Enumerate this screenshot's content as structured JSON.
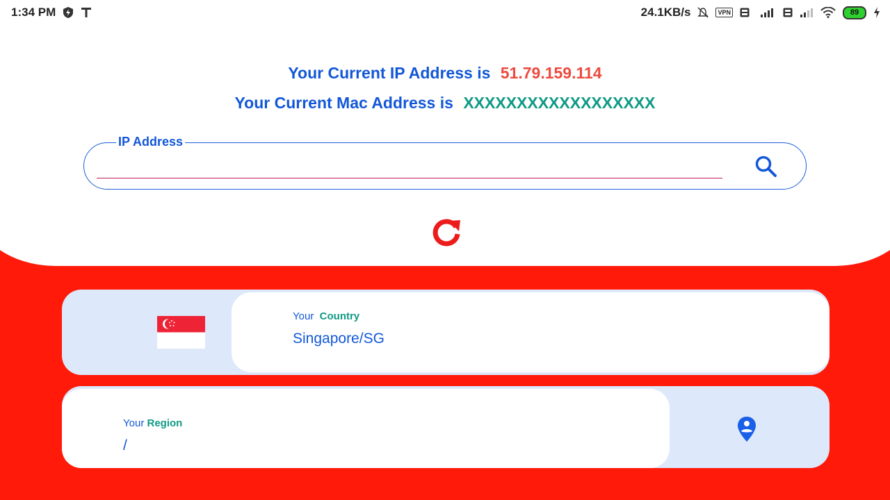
{
  "status_bar": {
    "time": "1:34 PM",
    "network_speed": "24.1KB/s",
    "vpn_label": "VPN",
    "battery_level": "89",
    "icons": [
      "shield-icon",
      "t-icon",
      "bell-off-icon",
      "vpn-icon",
      "volte-icon",
      "signal-icon",
      "wifi-icon",
      "battery-icon",
      "charging-icon"
    ]
  },
  "header": {
    "ip_label": "Your Current IP Address is",
    "ip_value": "51.79.159.114",
    "mac_label": "Your Current Mac Address is",
    "mac_value": "XXXXXXXXXXXXXXXXXX"
  },
  "search": {
    "label": "IP Address",
    "value": "",
    "placeholder": ""
  },
  "country": {
    "label_prefix": "Your",
    "label_accent": "Country",
    "value": "Singapore/SG",
    "flag": "singapore-flag"
  },
  "region": {
    "label_prefix": "Your",
    "label_accent": "Region",
    "value": "/"
  },
  "colors": {
    "background_red": "#ff1a0a",
    "primary_blue": "#1257d8",
    "ip_red": "#ec4b3f",
    "mac_teal": "#0f9a84",
    "card_blue": "#dde8fb"
  }
}
